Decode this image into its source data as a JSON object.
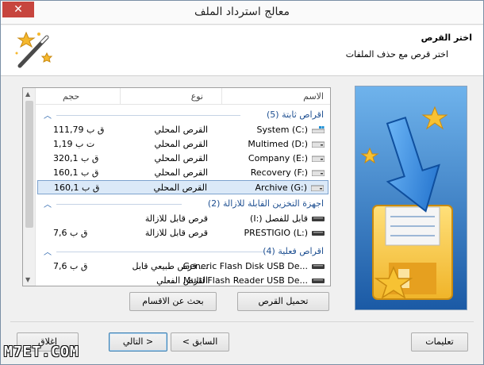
{
  "window": {
    "title": "معالج استرداد الملف",
    "close_glyph": "✕"
  },
  "header": {
    "step_title": "اختر القرص",
    "step_subtitle": "اختر قرص مع حذف الملفات"
  },
  "list": {
    "columns": {
      "name": "الاسم",
      "type": "نوع",
      "size": "حجم"
    },
    "groups": [
      {
        "name": "اقراص ثابتة (5)",
        "rows": [
          {
            "name": "System (C:)",
            "type": "القرص المحلي",
            "size": "111,79 ق ب",
            "icon": "system-drive-icon"
          },
          {
            "name": "Multimed (D:)",
            "type": "القرص المحلي",
            "size": "1,19 ت ب",
            "icon": "hard-drive-icon"
          },
          {
            "name": "Company (E:)",
            "type": "القرص المحلي",
            "size": "320,1 ق ب",
            "icon": "hard-drive-icon"
          },
          {
            "name": "Recovery (F:)",
            "type": "القرص المحلي",
            "size": "160,1 ق ب",
            "icon": "hard-drive-icon"
          },
          {
            "name": "Archive (G:)",
            "type": "القرص المحلي",
            "size": "160,1 ق ب",
            "icon": "hard-drive-icon",
            "selected": true
          }
        ]
      },
      {
        "name": "اجهزة التخزين القابلة للازالة (2)",
        "rows": [
          {
            "name": "(I:) قابل للفصل",
            "type": "قرص قابل للازالة",
            "size": "",
            "icon": "removable-drive-icon"
          },
          {
            "name": "PRESTIGIO (L:)",
            "type": "قرص قابل للازالة",
            "size": "7,6 ق ب",
            "icon": "removable-drive-icon"
          }
        ]
      },
      {
        "name": "اقراص فعلية (4)",
        "rows": [
          {
            "name": "Generic Flash Disk USB De...",
            "type": "قرص طبيعي قابل ...",
            "size": "7,6 ق ب",
            "icon": "flash-disk-icon"
          },
          {
            "name": "Multi Flash Reader USB De...",
            "type": "القرص الفعلي",
            "size": "",
            "icon": "flash-disk-icon"
          }
        ]
      }
    ]
  },
  "buttons": {
    "load_disk": "تحميل القرص",
    "find_partitions": "بحث عن الاقسام",
    "help": "تعليمات",
    "back": "< السابق",
    "next": "التالي >",
    "close": "إغلاق"
  },
  "watermark": "M7ET.COM",
  "colors": {
    "group_text": "#1e4f91",
    "selection": "#dbe9f8",
    "accent_blue": "#2b6fb8",
    "close_red": "#c7453e"
  }
}
